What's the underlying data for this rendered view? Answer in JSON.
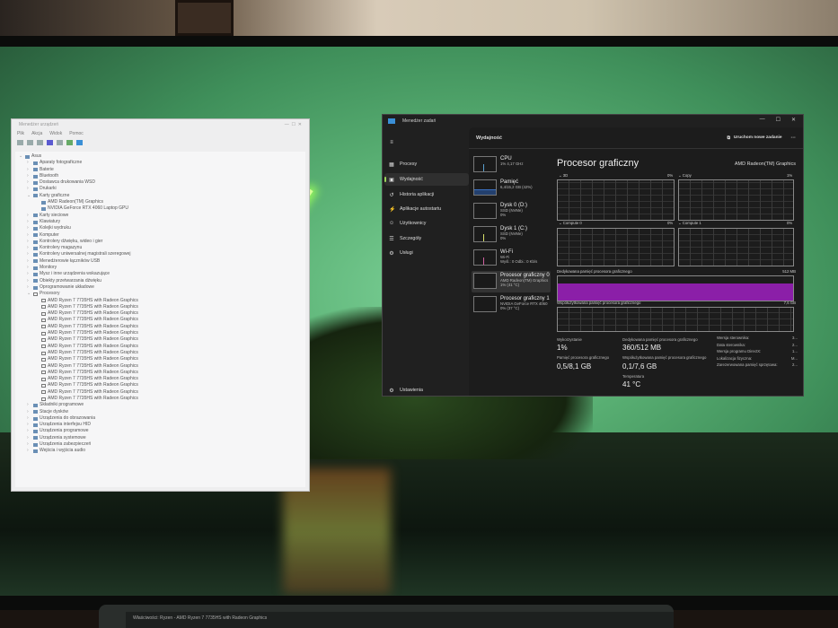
{
  "device_manager": {
    "title": "Menedżer urządzeń",
    "menu": [
      "Plik",
      "Akcja",
      "Widok",
      "Pomoc"
    ],
    "tree": [
      {
        "label": "Asus",
        "level": 0,
        "expanded": true
      },
      {
        "label": "Aparaty fotograficzne",
        "level": 1
      },
      {
        "label": "Baterie",
        "level": 1
      },
      {
        "label": "Bluetooth",
        "level": 1
      },
      {
        "label": "Dostawca drukowania WSD",
        "level": 1
      },
      {
        "label": "Drukarki",
        "level": 1
      },
      {
        "label": "Karty graficzne",
        "level": 1,
        "expanded": true
      },
      {
        "label": "AMD Radeon(TM) Graphics",
        "level": 2
      },
      {
        "label": "NVIDIA GeForce RTX 4060 Laptop GPU",
        "level": 2
      },
      {
        "label": "Karty sieciowe",
        "level": 1
      },
      {
        "label": "Klawiatury",
        "level": 1
      },
      {
        "label": "Kolejki wydruku",
        "level": 1
      },
      {
        "label": "Komputer",
        "level": 1
      },
      {
        "label": "Kontrolery dźwięku, wideo i gier",
        "level": 1
      },
      {
        "label": "Kontrolery magazynu",
        "level": 1
      },
      {
        "label": "Kontrolery uniwersalnej magistrali szeregowej",
        "level": 1
      },
      {
        "label": "Menedżerowie łączników USB",
        "level": 1
      },
      {
        "label": "Monitory",
        "level": 1
      },
      {
        "label": "Mysz i inne urządzenia wskazujące",
        "level": 1
      },
      {
        "label": "Obiekty przetwarzania dźwięku",
        "level": 1
      },
      {
        "label": "Oprogramowanie układowe",
        "level": 1
      },
      {
        "label": "Procesory",
        "level": 1,
        "expanded": true
      },
      {
        "label": "AMD Ryzen 7 7735HS with Radeon Graphics",
        "level": 2,
        "cpu": true
      },
      {
        "label": "AMD Ryzen 7 7735HS with Radeon Graphics",
        "level": 2,
        "cpu": true
      },
      {
        "label": "AMD Ryzen 7 7735HS with Radeon Graphics",
        "level": 2,
        "cpu": true
      },
      {
        "label": "AMD Ryzen 7 7735HS with Radeon Graphics",
        "level": 2,
        "cpu": true
      },
      {
        "label": "AMD Ryzen 7 7735HS with Radeon Graphics",
        "level": 2,
        "cpu": true
      },
      {
        "label": "AMD Ryzen 7 7735HS with Radeon Graphics",
        "level": 2,
        "cpu": true
      },
      {
        "label": "AMD Ryzen 7 7735HS with Radeon Graphics",
        "level": 2,
        "cpu": true
      },
      {
        "label": "AMD Ryzen 7 7735HS with Radeon Graphics",
        "level": 2,
        "cpu": true
      },
      {
        "label": "AMD Ryzen 7 7735HS with Radeon Graphics",
        "level": 2,
        "cpu": true
      },
      {
        "label": "AMD Ryzen 7 7735HS with Radeon Graphics",
        "level": 2,
        "cpu": true
      },
      {
        "label": "AMD Ryzen 7 7735HS with Radeon Graphics",
        "level": 2,
        "cpu": true
      },
      {
        "label": "AMD Ryzen 7 7735HS with Radeon Graphics",
        "level": 2,
        "cpu": true
      },
      {
        "label": "AMD Ryzen 7 7735HS with Radeon Graphics",
        "level": 2,
        "cpu": true
      },
      {
        "label": "AMD Ryzen 7 7735HS with Radeon Graphics",
        "level": 2,
        "cpu": true
      },
      {
        "label": "AMD Ryzen 7 7735HS with Radeon Graphics",
        "level": 2,
        "cpu": true
      },
      {
        "label": "AMD Ryzen 7 7735HS with Radeon Graphics",
        "level": 2,
        "cpu": true
      },
      {
        "label": "Składniki programowe",
        "level": 1
      },
      {
        "label": "Stacje dysków",
        "level": 1
      },
      {
        "label": "Urządzenia do obrazowania",
        "level": 1
      },
      {
        "label": "Urządzenia interfejsu HID",
        "level": 1
      },
      {
        "label": "Urządzenia programowe",
        "level": 1
      },
      {
        "label": "Urządzenia systemowe",
        "level": 1
      },
      {
        "label": "Urządzenia zabezpieczeń",
        "level": 1
      },
      {
        "label": "Wejścia i wyjścia audio",
        "level": 1
      }
    ]
  },
  "task_manager": {
    "title": "Menedżer zadań",
    "nav": [
      {
        "label": "Procesy",
        "icon": "grid-icon",
        "glyph": "▦"
      },
      {
        "label": "Wydajność",
        "icon": "performance-icon",
        "glyph": "▣",
        "selected": true
      },
      {
        "label": "Historia aplikacji",
        "icon": "history-icon",
        "glyph": "↺"
      },
      {
        "label": "Aplikacje autostartu",
        "icon": "startup-icon",
        "glyph": "⚡"
      },
      {
        "label": "Użytkownicy",
        "icon": "users-icon",
        "glyph": "☺"
      },
      {
        "label": "Szczegóły",
        "icon": "details-icon",
        "glyph": "☰"
      },
      {
        "label": "Usługi",
        "icon": "services-icon",
        "glyph": "⚙"
      }
    ],
    "settings_label": "Ustawienia",
    "header": "Wydajność",
    "run_task": "Uruchom nowe zadanie",
    "devices": [
      {
        "name": "CPU",
        "line1": "1% 4,17 GHz",
        "line2": ""
      },
      {
        "name": "Pamięć",
        "line1": "6,4/15,2 GB (42%)",
        "line2": ""
      },
      {
        "name": "Dysk 0 (D:)",
        "line1": "SSD (NVMe)",
        "line2": "0%"
      },
      {
        "name": "Dysk 1 (C:)",
        "line1": "SSD (NVMe)",
        "line2": "0%"
      },
      {
        "name": "Wi-Fi",
        "line1": "Wi-Fi",
        "line2": "Wyśl.: 0 Odbi.: 0 Kb/s"
      },
      {
        "name": "Procesor graficzny 0",
        "line1": "AMD Radeon(TM) Graphics",
        "line2": "1% (41 °C)",
        "selected": true
      },
      {
        "name": "Procesor graficzny 1",
        "line1": "NVIDIA GeForce RTX 4060",
        "line2": "0% (37 °C)"
      }
    ],
    "gpu": {
      "title": "Procesor graficzny",
      "name": "AMD Radeon(TM) Graphics",
      "engines": [
        {
          "label": "3D",
          "pct": "0%"
        },
        {
          "label": "Copy",
          "pct": "1%"
        },
        {
          "label": "Compute 0",
          "pct": "0%"
        },
        {
          "label": "Compute 1",
          "pct": "0%"
        }
      ],
      "dedicated_label": "Dedykowana pamięć procesora graficznego",
      "dedicated_max": "512 MB",
      "dedicated_fill": 0.7,
      "shared_label": "Współużytkowana pamięć procesora graficznego",
      "shared_max": "7,6 GB",
      "stats": {
        "util_label": "Wykorzystanie",
        "util": "1%",
        "mem_label": "Pamięć procesora graficznego",
        "mem": "0,5/8,1 GB",
        "ded_label": "Dedykowana pamięć procesora graficznego",
        "ded": "360/512 MB",
        "shr_label": "Współużytkowana pamięć procesora graficznego",
        "shr": "0,1/7,6 GB",
        "temp_label": "Temperatura",
        "temp": "41 °C"
      },
      "info": [
        {
          "k": "Wersja sterownika:",
          "v": "3..."
        },
        {
          "k": "Data sterownika:",
          "v": "2..."
        },
        {
          "k": "Wersja programu DirectX:",
          "v": "1..."
        },
        {
          "k": "Lokalizacja fizyczna:",
          "v": "M..."
        },
        {
          "k": "Zarezerwowana pamięć sprzętowa:",
          "v": "2..."
        }
      ]
    },
    "accent": "#9ad35a",
    "memory_color": "#8b1fa8"
  },
  "laptop_window": {
    "title": "Właściwości: Ryzen - AMD Ryzen 7 7735HS with Radeon Graphics"
  }
}
